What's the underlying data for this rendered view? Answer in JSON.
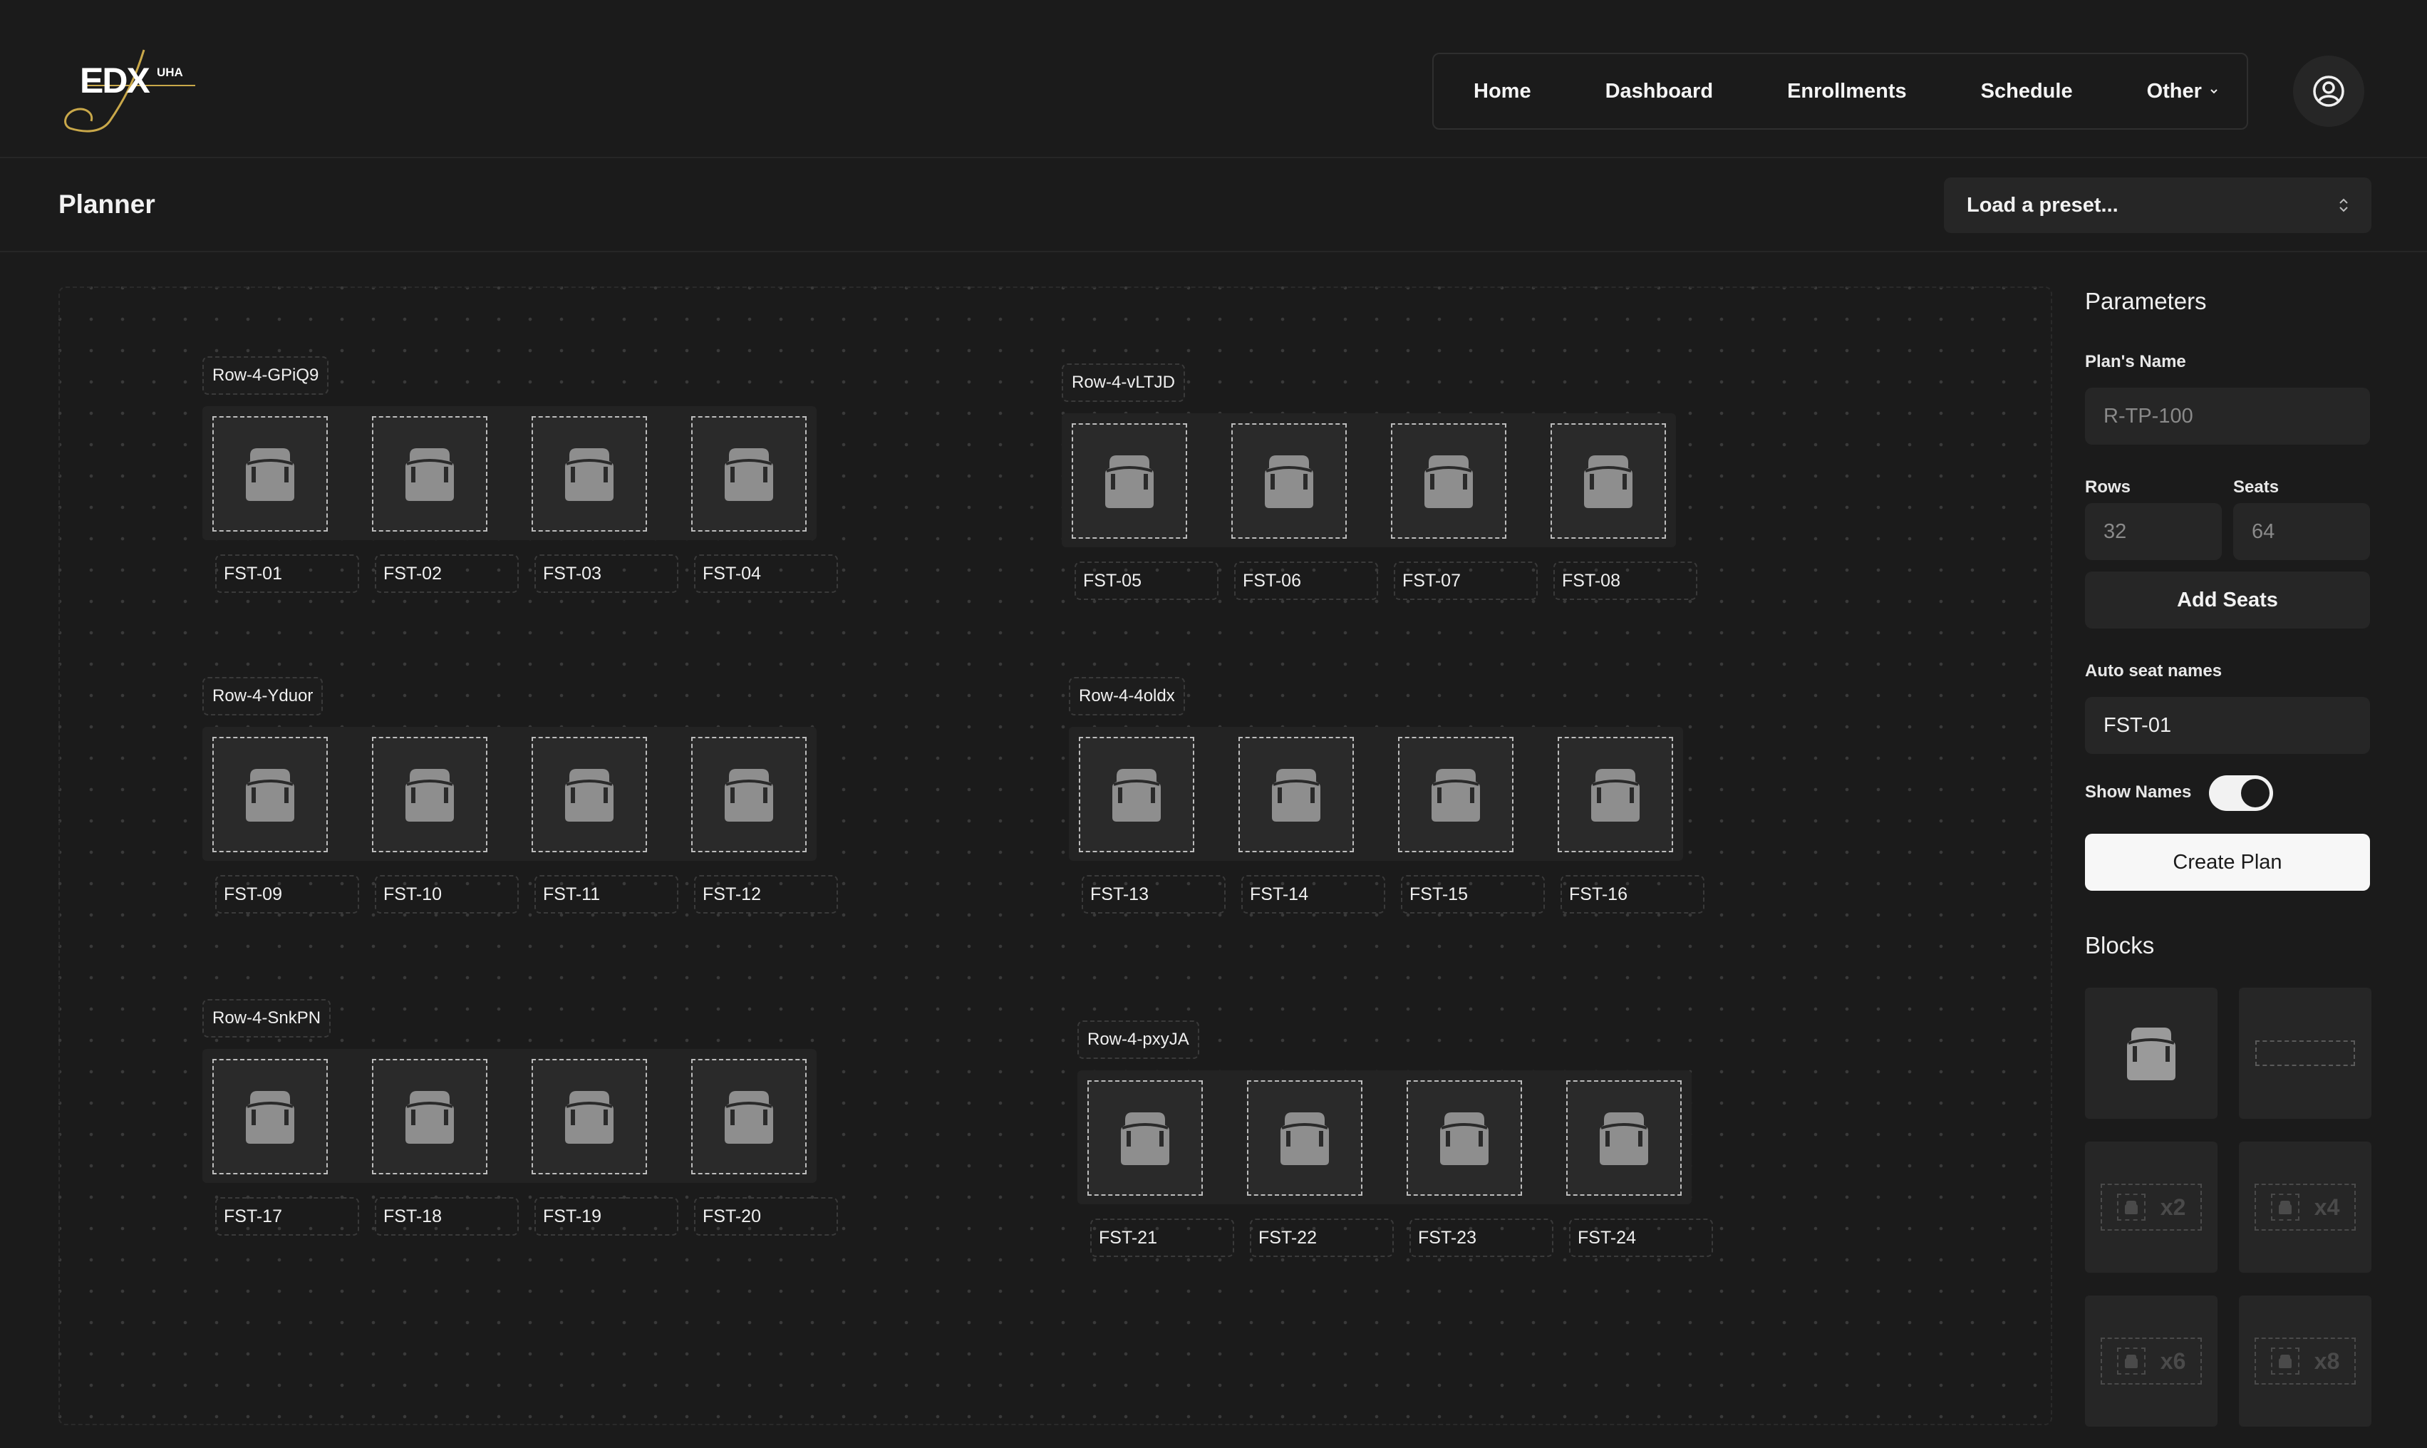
{
  "logo": {
    "text": "EDX",
    "sub": "UHA"
  },
  "nav": {
    "items": [
      "Home",
      "Dashboard",
      "Enrollments",
      "Schedule"
    ],
    "other_label": "Other",
    "profile_icon": "user-circle-icon"
  },
  "page": {
    "title": "Planner"
  },
  "preset": {
    "label": "Load a preset..."
  },
  "rows": [
    {
      "label": "Row-4-GPiQ9",
      "seats": [
        "FST-01",
        "FST-02",
        "FST-03",
        "FST-04"
      ]
    },
    {
      "label": "Row-4-vLTJD",
      "seats": [
        "FST-05",
        "FST-06",
        "FST-07",
        "FST-08"
      ]
    },
    {
      "label": "Row-4-Yduor",
      "seats": [
        "FST-09",
        "FST-10",
        "FST-11",
        "FST-12"
      ]
    },
    {
      "label": "Row-4-4oldx",
      "seats": [
        "FST-13",
        "FST-14",
        "FST-15",
        "FST-16"
      ]
    },
    {
      "label": "Row-4-SnkPN",
      "seats": [
        "FST-17",
        "FST-18",
        "FST-19",
        "FST-20"
      ]
    },
    {
      "label": "Row-4-pxyJA",
      "seats": [
        "FST-21",
        "FST-22",
        "FST-23",
        "FST-24"
      ]
    }
  ],
  "parameters": {
    "title": "Parameters",
    "plan_name_label": "Plan's Name",
    "plan_name_placeholder": "R-TP-100",
    "rows_label": "Rows",
    "rows_placeholder": "32",
    "seats_label": "Seats",
    "seats_placeholder": "64",
    "add_seats_label": "Add Seats",
    "auto_seat_label": "Auto seat names",
    "auto_seat_value": "FST-01",
    "show_names_label": "Show Names",
    "show_names_on": true,
    "create_plan_label": "Create Plan"
  },
  "blocks": {
    "title": "Blocks",
    "items": [
      "seat",
      "spacer",
      "x2",
      "x4",
      "x6",
      "x8"
    ]
  },
  "colors": {
    "background": "#1b1b1b",
    "panel": "#262626",
    "seat_icon": "#8e8e8e",
    "accent_light": "#f7f7f7"
  }
}
